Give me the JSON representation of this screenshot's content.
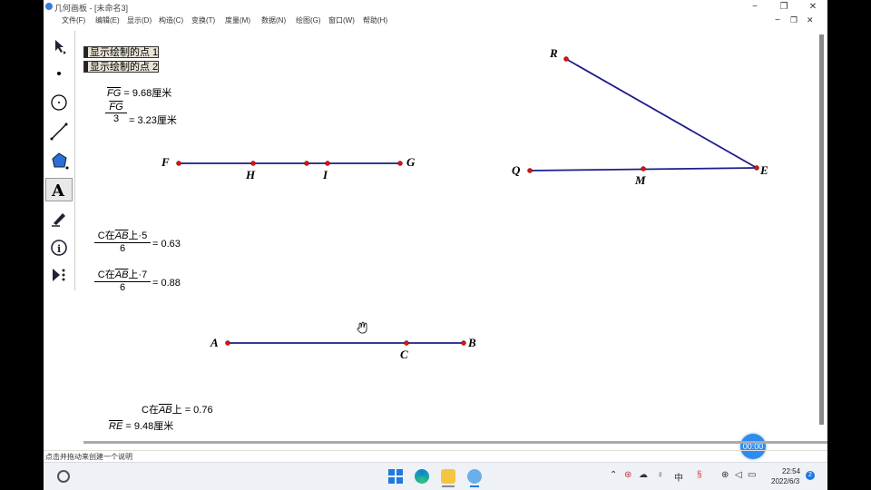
{
  "window": {
    "title": "几何画板 - [未命名3]",
    "controls": {
      "minimize": "−",
      "restore": "❐",
      "close": "✕"
    },
    "secondary_controls": {
      "minimize": "−",
      "restore": "❐",
      "close": "✕"
    }
  },
  "menu": [
    "文件(F)",
    "编辑(E)",
    "显示(D)",
    "构造(C)",
    "变换(T)",
    "度量(M)",
    "数据(N)",
    "绘图(G)",
    "窗口(W)",
    "帮助(H)"
  ],
  "toolbar": [
    "arrow-select-tool",
    "point-tool",
    "compass-tool",
    "straightedge-tool",
    "polygon-tool",
    "text-tool",
    "marker-tool",
    "information-tool",
    "custom-tool"
  ],
  "buttons": {
    "show1": "显示绘制的点 1",
    "show2": "显示绘制的点 2"
  },
  "measurements": {
    "fg_name": "FG",
    "fg_value": " = 9.68厘米",
    "fg3_num": "FG",
    "fg3_den": "3",
    "fg3_value": " = 3.23厘米",
    "c5_num_a": "C在",
    "c5_num_b": "AB",
    "c5_num_c": "上·5",
    "c5_den": "6",
    "c5_value": " = 0.63",
    "c7_num_a": "C在",
    "c7_num_b": "AB",
    "c7_num_c": "上·7",
    "c7_den": "6",
    "c7_value": " = 0.88",
    "c_a": "C在",
    "c_b": "AB",
    "c_c": "上",
    "c_value": " = 0.76",
    "re_name": "RE",
    "re_value": " = 9.48厘米"
  },
  "points": {
    "F": "F",
    "H": "H",
    "I": "I",
    "G": "G",
    "R": "R",
    "Q": "Q",
    "M": "M",
    "E": "E",
    "A": "A",
    "C": "C",
    "B": "B"
  },
  "colors": {
    "segment": "#1c1c8c",
    "point": "#e01010"
  },
  "timer": "00:00",
  "status": "点击并拖动来创建一个说明",
  "taskbar": {
    "ime": "中",
    "time": "22:54",
    "date": "2022/6/3",
    "notifications": "2"
  }
}
